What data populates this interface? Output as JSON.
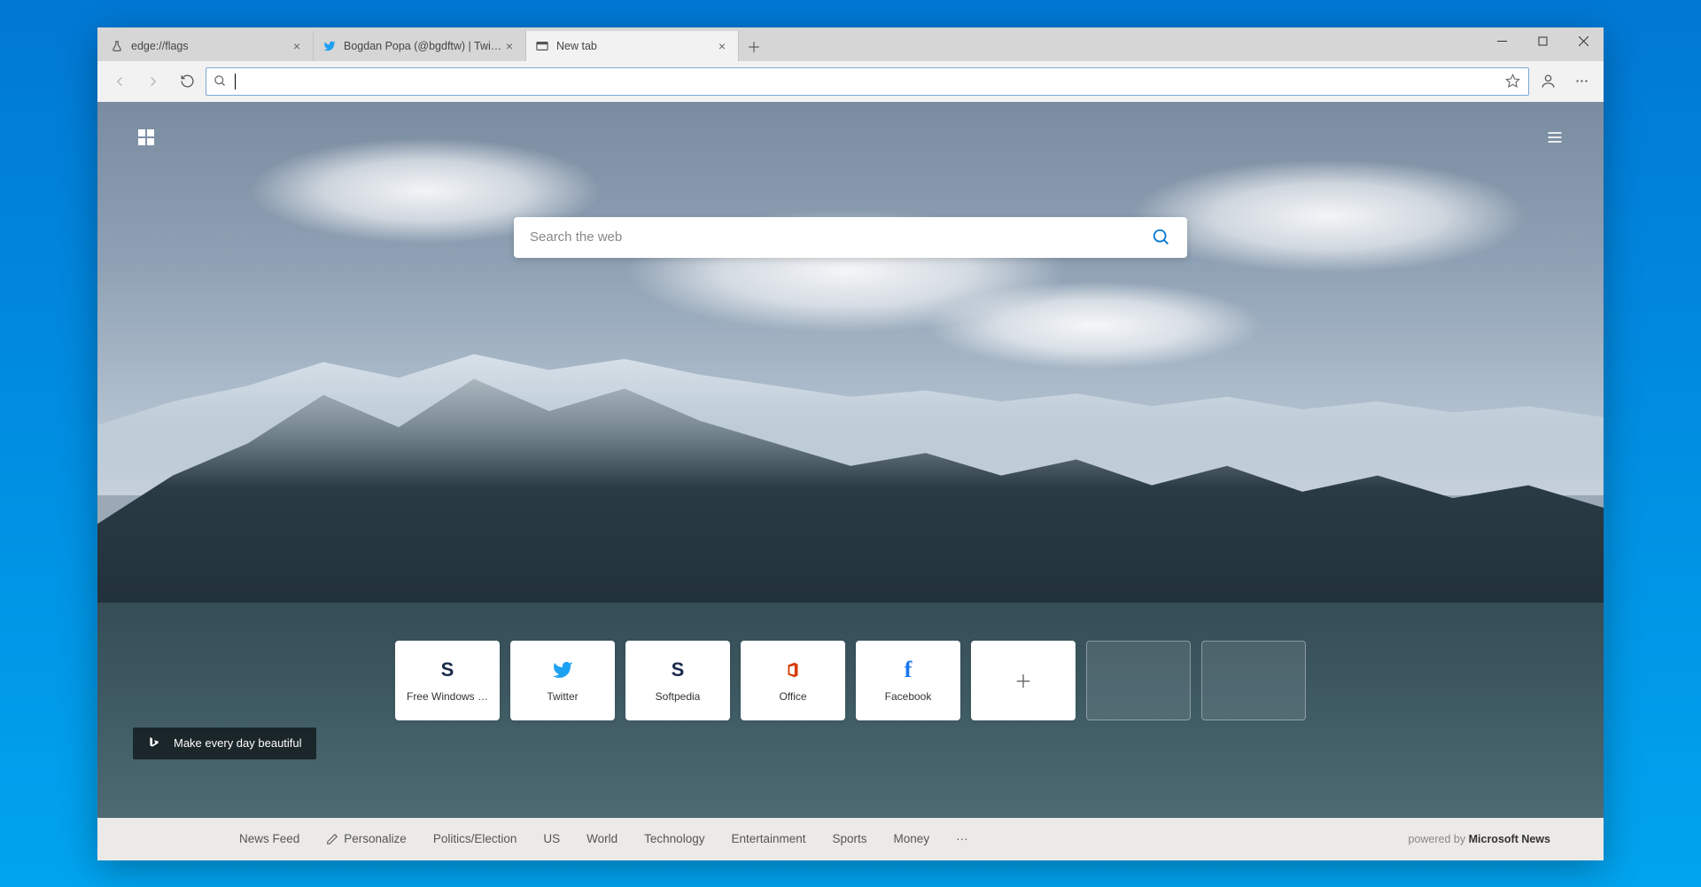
{
  "tabs": [
    {
      "title": "edge://flags",
      "icon": "flask"
    },
    {
      "title": "Bogdan Popa (@bgdftw) | Twitt…",
      "icon": "twitter"
    },
    {
      "title": "New tab",
      "icon": "newtab",
      "active": true
    }
  ],
  "addressbar": {
    "value": ""
  },
  "search": {
    "placeholder": "Search the web"
  },
  "quicklinks": [
    {
      "label": "Free Windows …",
      "icon": "softpedia",
      "color": "#1a2a4a"
    },
    {
      "label": "Twitter",
      "icon": "twitter",
      "color": "#1da1f2"
    },
    {
      "label": "Softpedia",
      "icon": "softpedia",
      "color": "#1a2a4a"
    },
    {
      "label": "Office",
      "icon": "office",
      "color": "#d83b01"
    },
    {
      "label": "Facebook",
      "icon": "facebook",
      "color": "#1877f2"
    }
  ],
  "bing_tagline": "Make every day beautiful",
  "bottombar": {
    "links": [
      "News Feed",
      "Personalize",
      "Politics/Election",
      "US",
      "World",
      "Technology",
      "Entertainment",
      "Sports",
      "Money"
    ],
    "powered_prefix": "powered by ",
    "powered_brand": "Microsoft News"
  }
}
